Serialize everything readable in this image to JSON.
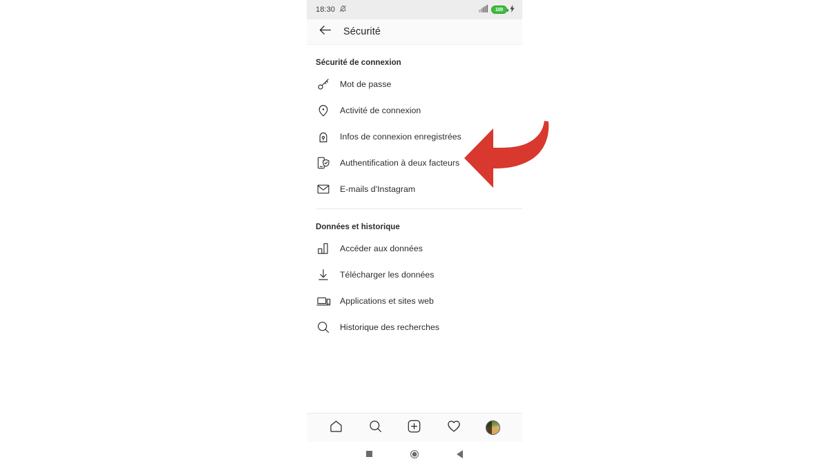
{
  "status_bar": {
    "time": "18:30",
    "silent_icon": "bell-slash-icon",
    "signal_icon": "signal-bars-icon",
    "battery_level": "100",
    "charging_icon": "lightning-bolt-icon"
  },
  "header": {
    "back_icon": "arrow-left-icon",
    "title": "Sécurité"
  },
  "sections": [
    {
      "title": "Sécurité de connexion",
      "items": [
        {
          "label": "Mot de passe",
          "icon": "key-icon"
        },
        {
          "label": "Activité de connexion",
          "icon": "location-pin-icon"
        },
        {
          "label": "Infos de connexion enregistrées",
          "icon": "lock-icon"
        },
        {
          "label": "Authentification à deux facteurs",
          "icon": "phone-shield-icon"
        },
        {
          "label": "E-mails d'Instagram",
          "icon": "envelope-icon"
        }
      ]
    },
    {
      "title": "Données et historique",
      "items": [
        {
          "label": "Accéder aux données",
          "icon": "bar-chart-icon"
        },
        {
          "label": "Télécharger les données",
          "icon": "download-icon"
        },
        {
          "label": "Applications et sites web",
          "icon": "laptop-phone-icon"
        },
        {
          "label": "Historique des recherches",
          "icon": "search-icon"
        }
      ]
    }
  ],
  "bottom_nav": [
    {
      "name": "home",
      "icon": "home-icon"
    },
    {
      "name": "search",
      "icon": "search-icon"
    },
    {
      "name": "create",
      "icon": "plus-square-icon"
    },
    {
      "name": "activity",
      "icon": "heart-icon"
    },
    {
      "name": "profile",
      "icon": "avatar-icon"
    }
  ],
  "system_nav": [
    {
      "name": "recents",
      "icon": "square-icon"
    },
    {
      "name": "home",
      "icon": "circle-icon"
    },
    {
      "name": "back",
      "icon": "triangle-left-icon"
    }
  ],
  "annotation": {
    "type": "curved-arrow",
    "direction": "left",
    "color": "#d8382e",
    "points_to": "Authentification à deux facteurs"
  }
}
